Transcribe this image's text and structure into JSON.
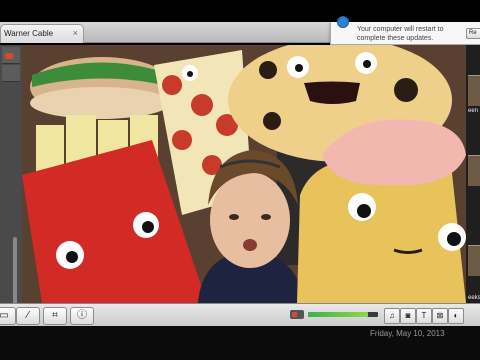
{
  "browser": {
    "tab_title": "Warner Cable",
    "tab_close": "×"
  },
  "notification": {
    "text": "Your computer will restart to complete these updates.",
    "button_label": "Re"
  },
  "right_panel": {
    "labels": [
      "een",
      "eeks"
    ]
  },
  "controls": {
    "left_buttons": [
      {
        "name": "view-toggle-button",
        "glyph": "▭"
      },
      {
        "name": "wand-tool-button",
        "glyph": "⁄"
      },
      {
        "name": "crop-tool-button",
        "glyph": "⌗"
      },
      {
        "name": "info-button",
        "glyph": "ⓘ"
      }
    ],
    "right_buttons": [
      {
        "name": "music-button",
        "glyph": "♫"
      },
      {
        "name": "camera-button",
        "glyph": "◙"
      },
      {
        "name": "title-button",
        "glyph": "T"
      },
      {
        "name": "transition-button",
        "glyph": "⊠"
      },
      {
        "name": "map-button",
        "glyph": "◐"
      }
    ],
    "audio_level": 0.85
  },
  "status": {
    "datetime": "Friday, May 10, 2013"
  },
  "colors": {
    "accent": "#2f7fd6",
    "level": "#39b44a"
  }
}
